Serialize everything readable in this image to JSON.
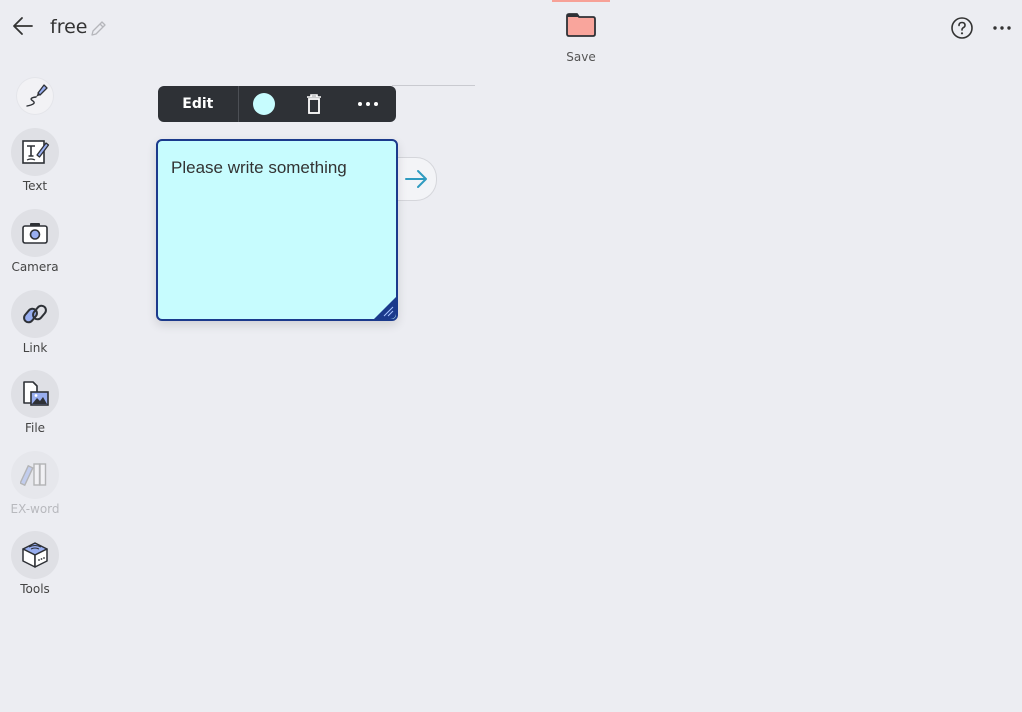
{
  "header": {
    "title": "free",
    "back_icon": "arrow-left-icon",
    "edit_title_icon": "pencil-icon",
    "save": {
      "label": "Save",
      "icon": "folder-icon",
      "color": "#f9a59c"
    },
    "help_icon": "question-circle-icon",
    "more_icon": "ellipsis-icon"
  },
  "sidebar": {
    "items": [
      {
        "id": "pen",
        "label": "",
        "icon": "pen-icon",
        "enabled": true
      },
      {
        "id": "text",
        "label": "Text",
        "icon": "text-icon",
        "enabled": true
      },
      {
        "id": "camera",
        "label": "Camera",
        "icon": "camera-icon",
        "enabled": true
      },
      {
        "id": "link",
        "label": "Link",
        "icon": "link-icon",
        "enabled": true
      },
      {
        "id": "file",
        "label": "File",
        "icon": "file-image-icon",
        "enabled": true
      },
      {
        "id": "exword",
        "label": "EX-word",
        "icon": "books-icon",
        "enabled": false
      },
      {
        "id": "tools",
        "label": "Tools",
        "icon": "toolbox-icon",
        "enabled": true
      }
    ]
  },
  "toolbar": {
    "edit_label": "Edit",
    "color_swatch": "#c7fcfe",
    "delete_icon": "trash-icon",
    "more_icon": "ellipsis-icon"
  },
  "note": {
    "text": "Please write something",
    "background": "#c7fcfe",
    "border": "#1b3a8c",
    "next_icon": "arrow-right-icon"
  }
}
